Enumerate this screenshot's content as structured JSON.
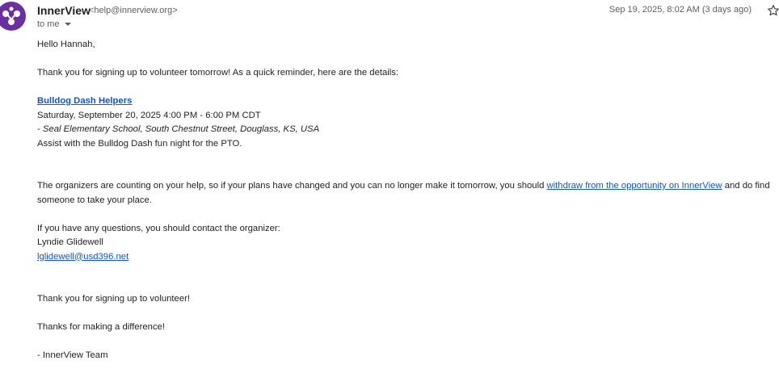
{
  "header": {
    "sender_name": "InnerView",
    "sender_email": "<help@innerview.org>",
    "to_label": "to me",
    "date": "Sep 19, 2025, 8:02 AM (3 days ago)",
    "avatar_icon": "innerview-logo",
    "avatar_color": "#6b2fa0",
    "star_icon": "star-outline-icon"
  },
  "body": {
    "greeting": "Hello Hannah,",
    "intro": "Thank you for signing up to volunteer tomorrow! As a quick reminder, here are the details:",
    "event": {
      "title": "Bulldog Dash Helpers",
      "datetime": "Saturday, September 20, 2025 4:00 PM - 6:00 PM CDT",
      "location": "- Seal Elementary School, South Chestnut Street, Douglass, KS, USA",
      "description": "Assist with the Bulldog Dash fun night for the PTO."
    },
    "organizers_text_before": "The organizers are counting on your help, so if your plans have changed and you can no longer make it tomorrow, you should ",
    "withdraw_link": "withdraw from the opportunity on InnerView",
    "organizers_text_after": " and do find someone to take your place.",
    "contact_intro": "If you have any questions, you should contact the organizer:",
    "organizer_name": "Lyndie Glidewell",
    "organizer_email": "lglidewell@usd396.net",
    "thanks_volunteer": "Thank you for signing up to volunteer!",
    "thanks_difference": "Thanks for making a difference!",
    "signature": "- InnerView Team"
  },
  "colors": {
    "link": "#1155cc",
    "text": "#222222",
    "muted": "#5e5e5e"
  }
}
